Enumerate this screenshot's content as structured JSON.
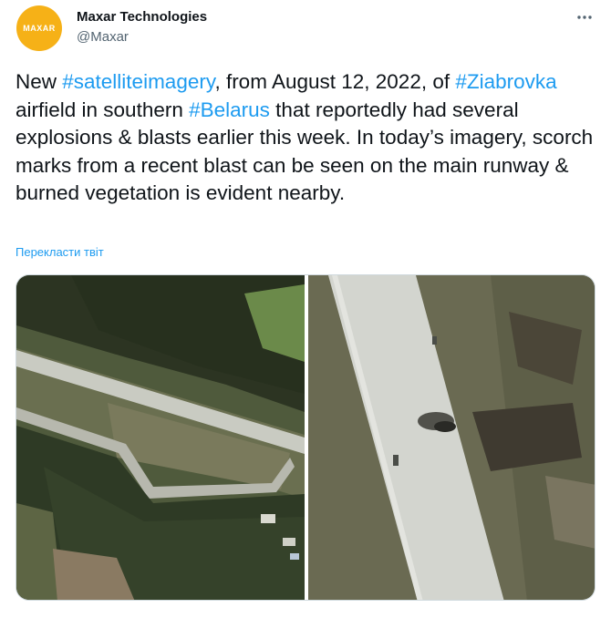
{
  "account": {
    "avatar_text": "MAXAR",
    "display_name": "Maxar Technologies",
    "handle": "@Maxar",
    "brand_color": "#f6b117"
  },
  "tweet": {
    "parts": [
      {
        "text": "New ",
        "tag": false
      },
      {
        "text": "#satelliteimagery",
        "tag": true
      },
      {
        "text": ", from August 12, 2022, of ",
        "tag": false
      },
      {
        "text": "#Ziabrovka",
        "tag": true
      },
      {
        "text": " airfield in southern ",
        "tag": false
      },
      {
        "text": "#Belarus",
        "tag": true
      },
      {
        "text": " that reportedly had several explosions & blasts earlier this week. In today’s imagery, scorch marks from a recent blast can be seen on the main runway & burned vegetation is evident nearby.",
        "tag": false
      }
    ],
    "link_color": "#1d9bf0"
  },
  "translate_label": "Перекласти твіт",
  "icons": {
    "more": "more-options-icon"
  },
  "media": {
    "images": [
      "satellite-airfield-overview",
      "satellite-runway-closeup"
    ]
  }
}
